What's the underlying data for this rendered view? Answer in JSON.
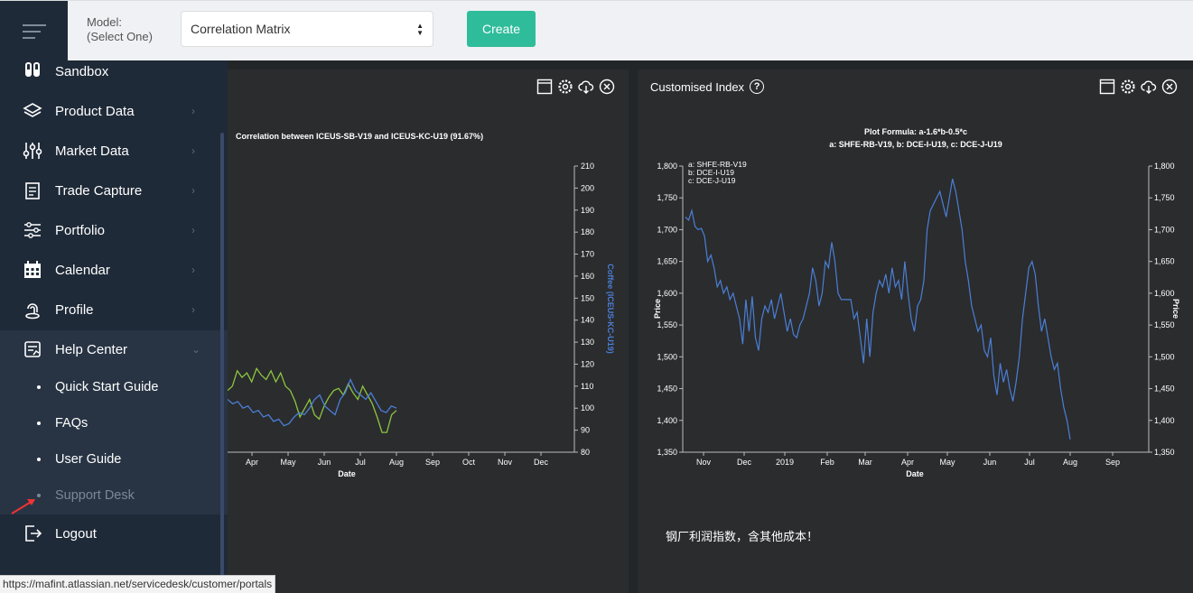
{
  "topbar": {
    "model_label_line1": "Model:",
    "model_label_line2": "(Select One)",
    "model_value": "Correlation Matrix",
    "create_label": "Create"
  },
  "sidebar": {
    "items": [
      {
        "label": "Sandbox",
        "icon": "flask-icon"
      },
      {
        "label": "Product Data",
        "icon": "layers-icon"
      },
      {
        "label": "Market Data",
        "icon": "sliders-icon"
      },
      {
        "label": "Trade Capture",
        "icon": "document-icon"
      },
      {
        "label": "Portfolio",
        "icon": "settings-lines-icon"
      },
      {
        "label": "Calendar",
        "icon": "calendar-icon"
      },
      {
        "label": "Profile",
        "icon": "fingerprint-icon"
      },
      {
        "label": "Help Center",
        "icon": "help-doc-icon"
      }
    ],
    "help_sub": [
      "Quick Start Guide",
      "FAQs",
      "User Guide",
      "Support Desk"
    ],
    "logout": "Logout"
  },
  "left_panel": {
    "chart_title": "Correlation between ICEUS-SB-V19 and ICEUS-KC-U19 (91.67%)"
  },
  "right_panel": {
    "title": "Customised Index",
    "chart_title_line1": "Plot Formula: a-1.6*b-0.5*c",
    "chart_title_line2": "a: SHFE-RB-V19, b: DCE-I-U19, c: DCE-J-U19",
    "note": "钢厂利润指数，含其他成本！"
  },
  "status_url": "https://mafint.atlassian.net/servicedesk/customer/portals",
  "chart_data": [
    {
      "type": "line",
      "title": "Correlation between ICEUS-SB-V19 and ICEUS-KC-U19 (91.67%)",
      "xlabel": "Date",
      "ylabel_right": "Coffee (ICEUS-KC-U19)",
      "x_ticks": [
        "Apr",
        "May",
        "Jun",
        "Jul",
        "Aug",
        "Sep",
        "Oct",
        "Nov",
        "Dec"
      ],
      "y_right_ticks": [
        "80",
        "90",
        "100",
        "110",
        "120",
        "130",
        "140",
        "150",
        "160",
        "170",
        "180",
        "190",
        "200",
        "210"
      ],
      "y_right_range": [
        80,
        210
      ],
      "series": [
        {
          "color": "#8cc63f",
          "values": [
            108,
            110,
            117,
            114,
            116,
            112,
            118,
            115,
            113,
            117,
            112,
            116,
            110,
            108,
            103,
            96,
            100,
            104,
            97,
            95,
            101,
            105,
            108,
            109,
            106,
            111,
            107,
            104,
            110,
            106,
            102,
            96,
            89,
            89,
            97,
            99
          ]
        },
        {
          "color": "#4a7fd6",
          "values": [
            104,
            102,
            103,
            100,
            101,
            98,
            99,
            96,
            97,
            94,
            95,
            92,
            93,
            96,
            98,
            97,
            100,
            104,
            106,
            101,
            99,
            97,
            104,
            107,
            113,
            108,
            106,
            104,
            107,
            103,
            99,
            98,
            101,
            100
          ]
        }
      ]
    },
    {
      "type": "line",
      "title": "Plot Formula: a-1.6*b-0.5*c",
      "subtitle": "a: SHFE-RB-V19, b: DCE-I-U19, c: DCE-J-U19",
      "legend": [
        "a: SHFE-RB-V19",
        "b: DCE-I-U19",
        "c: DCE-J-U19"
      ],
      "xlabel": "Date",
      "ylabel": "Price",
      "ylabel_right": "Price",
      "x_ticks": [
        "Nov",
        "Dec",
        "2019",
        "Feb",
        "Mar",
        "Apr",
        "May",
        "Jun",
        "Jul",
        "Aug",
        "Sep"
      ],
      "y_ticks": [
        "1,350",
        "1,400",
        "1,450",
        "1,500",
        "1,550",
        "1,600",
        "1,650",
        "1,700",
        "1,750",
        "1,800"
      ],
      "y_range": [
        1350,
        1800
      ],
      "series": [
        {
          "color": "#4a7fd6",
          "values": [
            1720,
            1715,
            1730,
            1705,
            1700,
            1702,
            1690,
            1650,
            1660,
            1640,
            1610,
            1620,
            1600,
            1610,
            1590,
            1600,
            1580,
            1560,
            1520,
            1590,
            1540,
            1595,
            1530,
            1510,
            1560,
            1580,
            1570,
            1590,
            1560,
            1580,
            1600,
            1570,
            1540,
            1560,
            1535,
            1530,
            1550,
            1560,
            1580,
            1600,
            1640,
            1620,
            1580,
            1600,
            1650,
            1640,
            1680,
            1650,
            1600,
            1590,
            1590,
            1590,
            1590,
            1560,
            1570,
            1530,
            1490,
            1560,
            1500,
            1570,
            1600,
            1620,
            1610,
            1630,
            1600,
            1640,
            1610,
            1620,
            1590,
            1650,
            1600,
            1560,
            1540,
            1580,
            1590,
            1620,
            1700,
            1730,
            1740,
            1750,
            1760,
            1740,
            1720,
            1750,
            1780,
            1760,
            1730,
            1700,
            1650,
            1620,
            1580,
            1560,
            1540,
            1550,
            1510,
            1500,
            1530,
            1470,
            1440,
            1490,
            1460,
            1480,
            1450,
            1430,
            1460,
            1500,
            1560,
            1600,
            1640,
            1650,
            1630,
            1580,
            1540,
            1560,
            1530,
            1500,
            1480,
            1490,
            1450,
            1420,
            1400,
            1370
          ],
          "note": "approximate series read from plot"
        }
      ]
    }
  ]
}
